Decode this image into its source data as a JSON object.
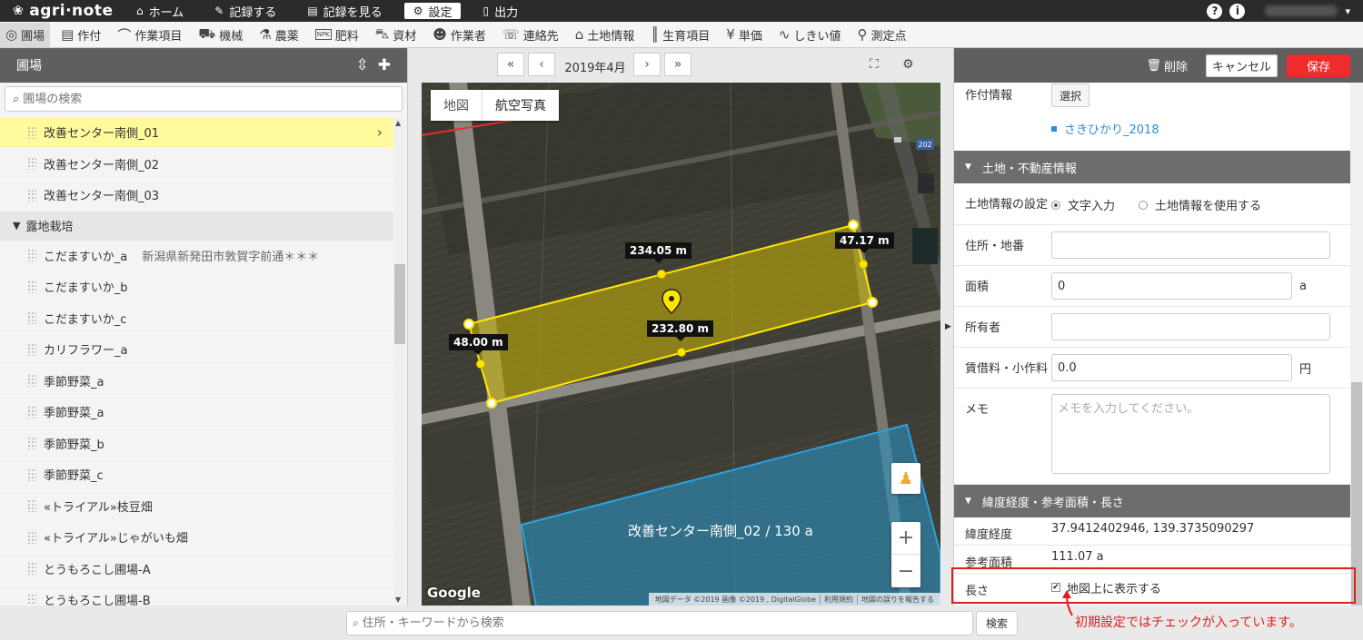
{
  "app": {
    "logo": "agri·note"
  },
  "topnav": [
    {
      "icon": "home-icon",
      "glyph": "⌂",
      "label": "ホーム",
      "active": false
    },
    {
      "icon": "pencil-icon",
      "glyph": "✎",
      "label": "記録する",
      "active": false
    },
    {
      "icon": "book-icon",
      "glyph": "▤",
      "label": "記録を見る",
      "active": false
    },
    {
      "icon": "gear-icon",
      "glyph": "⚙",
      "label": "設定",
      "active": true
    },
    {
      "icon": "document-icon",
      "glyph": "▯",
      "label": "出力",
      "active": false
    }
  ],
  "topright": {
    "help": "?",
    "info": "i"
  },
  "subnav": [
    {
      "icon": "map-pin-icon",
      "glyph": "◎",
      "label": "圃場",
      "active": true
    },
    {
      "icon": "list-icon",
      "glyph": "▤",
      "label": "作付",
      "active": false
    },
    {
      "icon": "sickle-icon",
      "glyph": "⌒",
      "label": "作業項目",
      "active": false
    },
    {
      "icon": "tractor-icon",
      "glyph": "⛟",
      "label": "機械",
      "active": false
    },
    {
      "icon": "flask-icon",
      "glyph": "⚗",
      "label": "農薬",
      "active": false
    },
    {
      "icon": "npk-icon",
      "glyph": "NPK",
      "label": "肥料",
      "active": false
    },
    {
      "icon": "wheelbarrow-icon",
      "glyph": "⛍",
      "label": "資材",
      "active": false
    },
    {
      "icon": "worker-icon",
      "glyph": "☻",
      "label": "作業者",
      "active": false
    },
    {
      "icon": "contact-icon",
      "glyph": "☏",
      "label": "連絡先",
      "active": false
    },
    {
      "icon": "land-icon",
      "glyph": "⌂",
      "label": "土地情報",
      "active": false
    },
    {
      "icon": "growth-icon",
      "glyph": "║",
      "label": "生育項目",
      "active": false
    },
    {
      "icon": "yen-icon",
      "glyph": "¥",
      "label": "単価",
      "active": false
    },
    {
      "icon": "threshold-icon",
      "glyph": "∿",
      "label": "しきい値",
      "active": false
    },
    {
      "icon": "measure-point-icon",
      "glyph": "⚲",
      "label": "測定点",
      "active": false
    }
  ],
  "left": {
    "title": "圃場",
    "search_placeholder": "圃場の検索",
    "items": [
      {
        "type": "row",
        "label": "改善センター南側_01",
        "selected": true
      },
      {
        "type": "row",
        "label": "改善センター南側_02"
      },
      {
        "type": "row",
        "label": "改善センター南側_03"
      },
      {
        "type": "group",
        "label": "露地栽培"
      },
      {
        "type": "row",
        "label": "こだますいか_a",
        "sub": "新潟県新発田市敦賀字前通＊＊＊"
      },
      {
        "type": "row",
        "label": "こだますいか_b"
      },
      {
        "type": "row",
        "label": "こだますいか_c"
      },
      {
        "type": "row",
        "label": "カリフラワー_a"
      },
      {
        "type": "row",
        "label": "季節野菜_a"
      },
      {
        "type": "row",
        "label": "季節野菜_a"
      },
      {
        "type": "row",
        "label": "季節野菜_b"
      },
      {
        "type": "row",
        "label": "季節野菜_c"
      },
      {
        "type": "row",
        "label": "«トライアル»枝豆畑"
      },
      {
        "type": "row",
        "label": "«トライアル»じゃがいも畑"
      },
      {
        "type": "row",
        "label": "とうもろこし圃場-A"
      },
      {
        "type": "row",
        "label": "とうもろこし圃場-B"
      }
    ]
  },
  "map": {
    "date": "2019年4月",
    "type_map": "地図",
    "type_satellite": "航空写真",
    "measurements": {
      "top": "234.05 m",
      "right": "47.17 m",
      "left": "48.00 m",
      "bottom": "232.80 m"
    },
    "field_label": "改善センター南側_02  /  130 a",
    "road_number": "202",
    "google": "Google",
    "attribution": [
      "地図データ ©2019 画像 ©2019 , DigitalGlobe",
      "利用規約",
      "地図の誤りを報告する"
    ],
    "colors": {
      "selected_field": "#ffe600",
      "other_field": "#2aa3e0"
    }
  },
  "right": {
    "delete_label": "削除",
    "cancel_label": "キャンセル",
    "save_label": "保存",
    "crop_label": "作付情報",
    "crop_select": "選択",
    "crop_link": "さきひかり_2018",
    "section_land": "土地・不動産情報",
    "land_setting_label": "土地情報の設定",
    "radio_text": "文字入力",
    "radio_land": "土地情報を使用する",
    "address_label": "住所・地番",
    "area_label": "面積",
    "area_value": "0",
    "area_unit": "a",
    "owner_label": "所有者",
    "rent_label": "賃借料・小作料",
    "rent_value": "0.0",
    "rent_unit": "円",
    "memo_label": "メモ",
    "memo_placeholder": "メモを入力してください。",
    "section_geo": "緯度経度・参考面積・長さ",
    "latlng_label": "緯度経度",
    "latlng_value": "37.9412402946, 139.3735090297",
    "ref_area_label": "参考面積",
    "ref_area_value": "111.07 a",
    "length_label": "長さ",
    "length_checkbox": "地図上に表示する"
  },
  "bottom": {
    "search_placeholder": "住所・キーワードから検索",
    "search_button": "検索"
  },
  "annotation": "初期設定ではチェックが入っています。",
  "accent": {
    "save": "#ef2b2b",
    "highlight": "#e11d1d",
    "selected_row": "#fffa9c",
    "link": "#2a8fd6"
  }
}
